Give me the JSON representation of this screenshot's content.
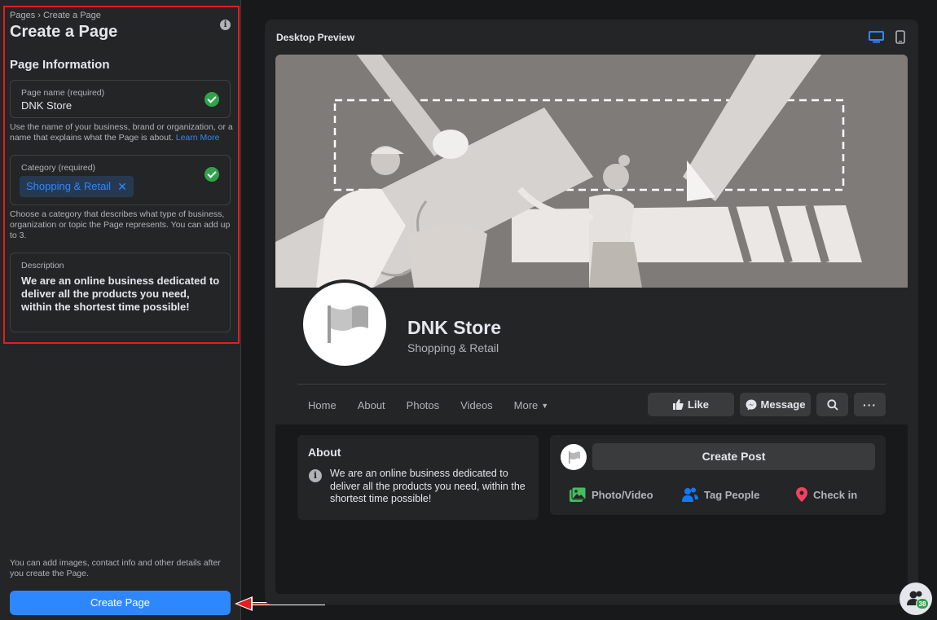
{
  "sidebar": {
    "breadcrumb": "Pages › Create a Page",
    "title": "Create a Page",
    "section_heading": "Page Information",
    "page_name": {
      "label": "Page name (required)",
      "value": "DNK Store",
      "helper": "Use the name of your business, brand or organization, or a name that explains what the Page is about.",
      "learn_more": "Learn More"
    },
    "category": {
      "label": "Category (required)",
      "chip": "Shopping & Retail",
      "helper": "Choose a category that describes what type of business, organization or topic the Page represents. You can add up to 3."
    },
    "description": {
      "label": "Description",
      "value": "We are an online business dedicated to deliver all the products you need, within the shortest time possible!"
    },
    "bottom_note": "You can add images, contact info and other details after you create the Page.",
    "create_button": "Create Page"
  },
  "preview": {
    "label": "Desktop Preview",
    "page_name": "DNK Store",
    "page_category": "Shopping & Retail",
    "tabs": [
      "Home",
      "About",
      "Photos",
      "Videos",
      "More"
    ],
    "actions": {
      "like": "Like",
      "message": "Message"
    },
    "about": {
      "title": "About",
      "text": "We are an online business dedicated to deliver all the products you need, within the shortest time possible!"
    },
    "post": {
      "create": "Create Post",
      "photo_video": "Photo/Video",
      "tag_people": "Tag People",
      "check_in": "Check in"
    }
  },
  "floating": {
    "badge": "38"
  },
  "colors": {
    "accent": "#2d88ff",
    "success": "#31a24c",
    "highlight": "#e41e1e"
  }
}
